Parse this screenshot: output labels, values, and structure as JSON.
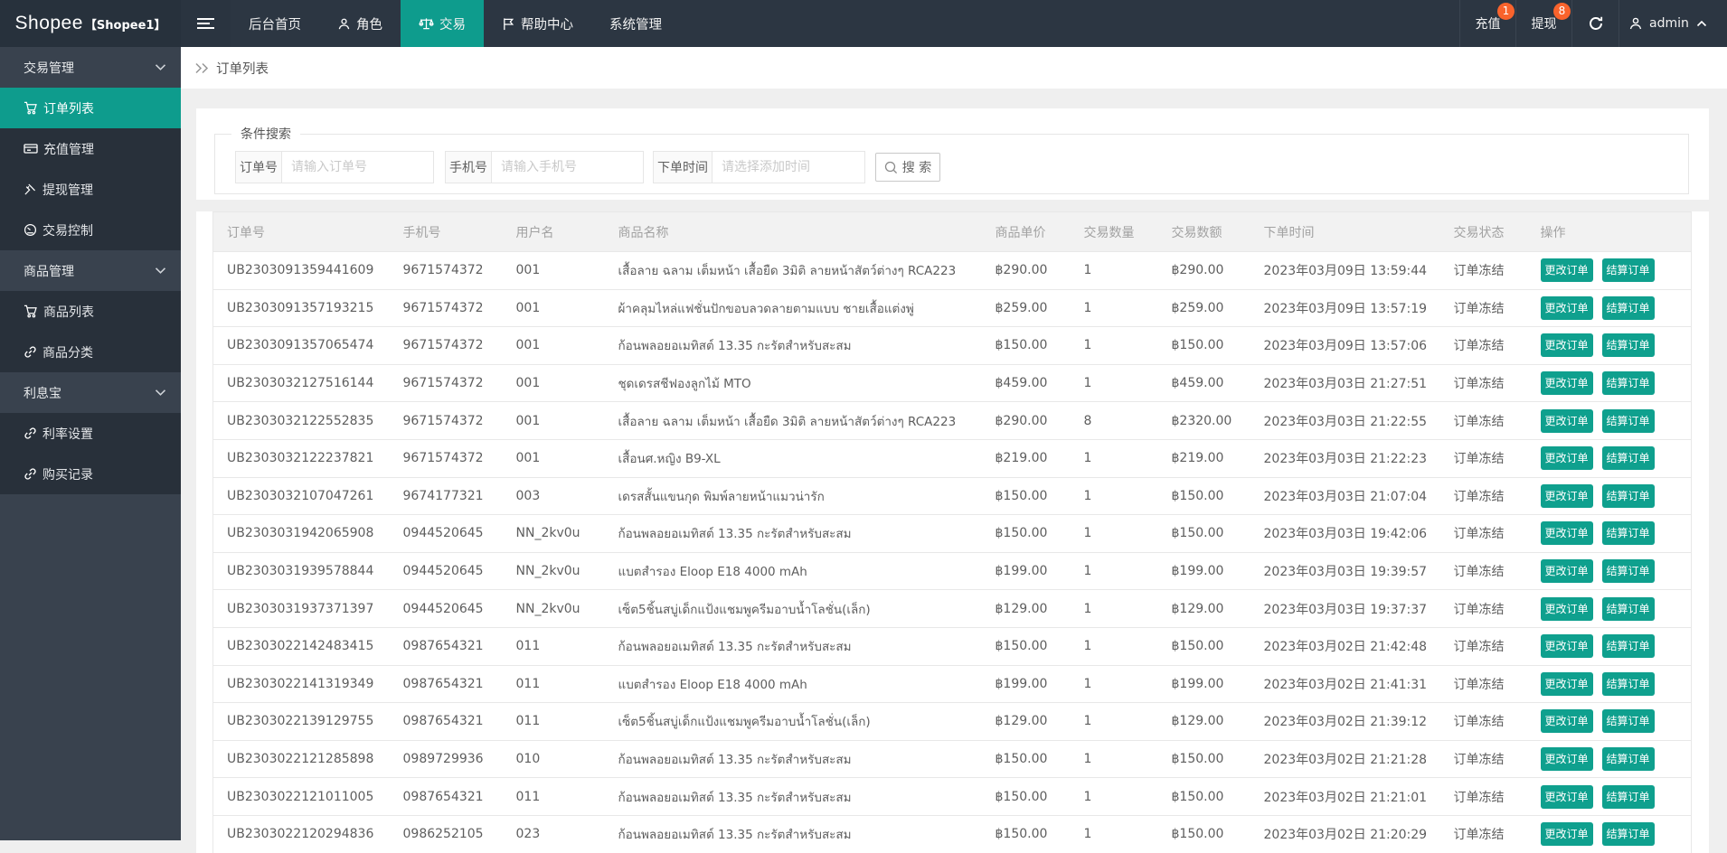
{
  "header": {
    "logo": "Shopee",
    "logo_badge": "【Shopee1】",
    "menu": [
      {
        "label": "后台首页",
        "icon": null,
        "active": false
      },
      {
        "label": "角色",
        "icon": "user",
        "active": false
      },
      {
        "label": "交易",
        "icon": "scale",
        "active": true
      },
      {
        "label": "帮助中心",
        "icon": "flag",
        "active": false
      },
      {
        "label": "系统管理",
        "icon": null,
        "active": false
      }
    ],
    "right": {
      "recharge_label": "充值",
      "recharge_badge": "1",
      "withdraw_label": "提现",
      "withdraw_badge": "8",
      "username": "admin"
    }
  },
  "sidebar": {
    "groups": [
      {
        "label": "交易管理",
        "items": [
          {
            "label": "订单列表",
            "icon": "cart",
            "active": true
          },
          {
            "label": "充值管理",
            "icon": "card",
            "active": false
          },
          {
            "label": "提现管理",
            "icon": "gavel",
            "active": false
          },
          {
            "label": "交易控制",
            "icon": "gauge",
            "active": false
          }
        ]
      },
      {
        "label": "商品管理",
        "items": [
          {
            "label": "商品列表",
            "icon": "cart",
            "active": false
          },
          {
            "label": "商品分类",
            "icon": "link",
            "active": false
          }
        ]
      },
      {
        "label": "利息宝",
        "items": [
          {
            "label": "利率设置",
            "icon": "link",
            "active": false
          },
          {
            "label": "购买记录",
            "icon": "link",
            "active": false
          }
        ]
      }
    ]
  },
  "breadcrumb": {
    "title": "订单列表"
  },
  "search": {
    "legend": "条件搜索",
    "fields": [
      {
        "label": "订单号",
        "placeholder": "请输入订单号"
      },
      {
        "label": "手机号",
        "placeholder": "请输入手机号"
      },
      {
        "label": "下单时间",
        "placeholder": "请选择添加时间"
      }
    ],
    "button": "搜 索"
  },
  "table": {
    "columns": [
      "订单号",
      "手机号",
      "用户名",
      "商品名称",
      "商品单价",
      "交易数量",
      "交易数额",
      "下单时间",
      "交易状态",
      "操作"
    ],
    "action_labels": [
      "更改订单",
      "结算订单"
    ],
    "rows": [
      {
        "order_no": "UB2303091359441609",
        "phone": "9671574372",
        "user": "001",
        "product": "เสื้อลาย ฉลาม เต็มหน้า เสื้อยืด 3มิติ ลายหน้าสัตว์ต่างๆ RCA223",
        "price": "฿290.00",
        "qty": "1",
        "amount": "฿290.00",
        "time": "2023年03月09日 13:59:44",
        "status": "订单冻结"
      },
      {
        "order_no": "UB2303091357193215",
        "phone": "9671574372",
        "user": "001",
        "product": "ผ้าคลุมไหล่แฟชั่นปักขอบลวดลายตามแบบ ชายเสื้อแต่งพู่",
        "price": "฿259.00",
        "qty": "1",
        "amount": "฿259.00",
        "time": "2023年03月09日 13:57:19",
        "status": "订单冻结"
      },
      {
        "order_no": "UB2303091357065474",
        "phone": "9671574372",
        "user": "001",
        "product": "ก้อนพลอยอเมทิสต์ 13.35 กะรัตสำหรับสะสม",
        "price": "฿150.00",
        "qty": "1",
        "amount": "฿150.00",
        "time": "2023年03月09日 13:57:06",
        "status": "订单冻结"
      },
      {
        "order_no": "UB2303032127516144",
        "phone": "9671574372",
        "user": "001",
        "product": "ชุดเดรสชีฟองลูกไม้ MTO",
        "price": "฿459.00",
        "qty": "1",
        "amount": "฿459.00",
        "time": "2023年03月03日 21:27:51",
        "status": "订单冻结"
      },
      {
        "order_no": "UB2303032122552835",
        "phone": "9671574372",
        "user": "001",
        "product": "เสื้อลาย ฉลาม เต็มหน้า เสื้อยืด 3มิติ ลายหน้าสัตว์ต่างๆ RCA223",
        "price": "฿290.00",
        "qty": "8",
        "amount": "฿2320.00",
        "time": "2023年03月03日 21:22:55",
        "status": "订单冻结"
      },
      {
        "order_no": "UB2303032122237821",
        "phone": "9671574372",
        "user": "001",
        "product": "เสื้อนศ.หญิง B9-XL",
        "price": "฿219.00",
        "qty": "1",
        "amount": "฿219.00",
        "time": "2023年03月03日 21:22:23",
        "status": "订单冻结"
      },
      {
        "order_no": "UB2303032107047261",
        "phone": "9674177321",
        "user": "003",
        "product": "เดรสสั้นแขนกุด พิมพ์ลายหน้าแมวน่ารัก",
        "price": "฿150.00",
        "qty": "1",
        "amount": "฿150.00",
        "time": "2023年03月03日 21:07:04",
        "status": "订单冻结"
      },
      {
        "order_no": "UB2303031942065908",
        "phone": "0944520645",
        "user": "NN_2kv0u",
        "product": "ก้อนพลอยอเมทิสต์ 13.35 กะรัตสำหรับสะสม",
        "price": "฿150.00",
        "qty": "1",
        "amount": "฿150.00",
        "time": "2023年03月03日 19:42:06",
        "status": "订单冻结"
      },
      {
        "order_no": "UB2303031939578844",
        "phone": "0944520645",
        "user": "NN_2kv0u",
        "product": "แบตสำรอง Eloop E18 4000 mAh",
        "price": "฿199.00",
        "qty": "1",
        "amount": "฿199.00",
        "time": "2023年03月03日 19:39:57",
        "status": "订单冻结"
      },
      {
        "order_no": "UB2303031937371397",
        "phone": "0944520645",
        "user": "NN_2kv0u",
        "product": "เซ็ต5ชิ้นสบู่เด็กแป้งแชมพูครีมอาบน้ำโลชั่น(เล็ก)",
        "price": "฿129.00",
        "qty": "1",
        "amount": "฿129.00",
        "time": "2023年03月03日 19:37:37",
        "status": "订单冻结"
      },
      {
        "order_no": "UB2303022142483415",
        "phone": "0987654321",
        "user": "011",
        "product": "ก้อนพลอยอเมทิสต์ 13.35 กะรัตสำหรับสะสม",
        "price": "฿150.00",
        "qty": "1",
        "amount": "฿150.00",
        "time": "2023年03月02日 21:42:48",
        "status": "订单冻结"
      },
      {
        "order_no": "UB2303022141319349",
        "phone": "0987654321",
        "user": "011",
        "product": "แบตสำรอง Eloop E18 4000 mAh",
        "price": "฿199.00",
        "qty": "1",
        "amount": "฿199.00",
        "time": "2023年03月02日 21:41:31",
        "status": "订单冻结"
      },
      {
        "order_no": "UB2303022139129755",
        "phone": "0987654321",
        "user": "011",
        "product": "เซ็ต5ชิ้นสบู่เด็กแป้งแชมพูครีมอาบน้ำโลชั่น(เล็ก)",
        "price": "฿129.00",
        "qty": "1",
        "amount": "฿129.00",
        "time": "2023年03月02日 21:39:12",
        "status": "订单冻结"
      },
      {
        "order_no": "UB2303022121285898",
        "phone": "0989729936",
        "user": "010",
        "product": "ก้อนพลอยอเมทิสต์ 13.35 กะรัตสำหรับสะสม",
        "price": "฿150.00",
        "qty": "1",
        "amount": "฿150.00",
        "time": "2023年03月02日 21:21:28",
        "status": "订单冻结"
      },
      {
        "order_no": "UB2303022121011005",
        "phone": "0987654321",
        "user": "011",
        "product": "ก้อนพลอยอเมทิสต์ 13.35 กะรัตสำหรับสะสม",
        "price": "฿150.00",
        "qty": "1",
        "amount": "฿150.00",
        "time": "2023年03月02日 21:21:01",
        "status": "订单冻结"
      },
      {
        "order_no": "UB2303022120294836",
        "phone": "0986252105",
        "user": "023",
        "product": "ก้อนพลอยอเมทิสต์ 13.35 กะรัตสำหรับสะสม",
        "price": "฿150.00",
        "qty": "1",
        "amount": "฿150.00",
        "time": "2023年03月02日 21:20:29",
        "status": "订单冻结"
      }
    ]
  },
  "colors": {
    "navbar_bg": "#2c3642",
    "sidebar_bg": "#39424e",
    "sidebar_submenu_bg": "#28303a",
    "accent_teal": "#0e9c8d",
    "badge_orange": "#f9632c",
    "panel_bg": "#ffffff",
    "content_bg": "#efefef",
    "table_header_bg": "#f2f2f2"
  }
}
